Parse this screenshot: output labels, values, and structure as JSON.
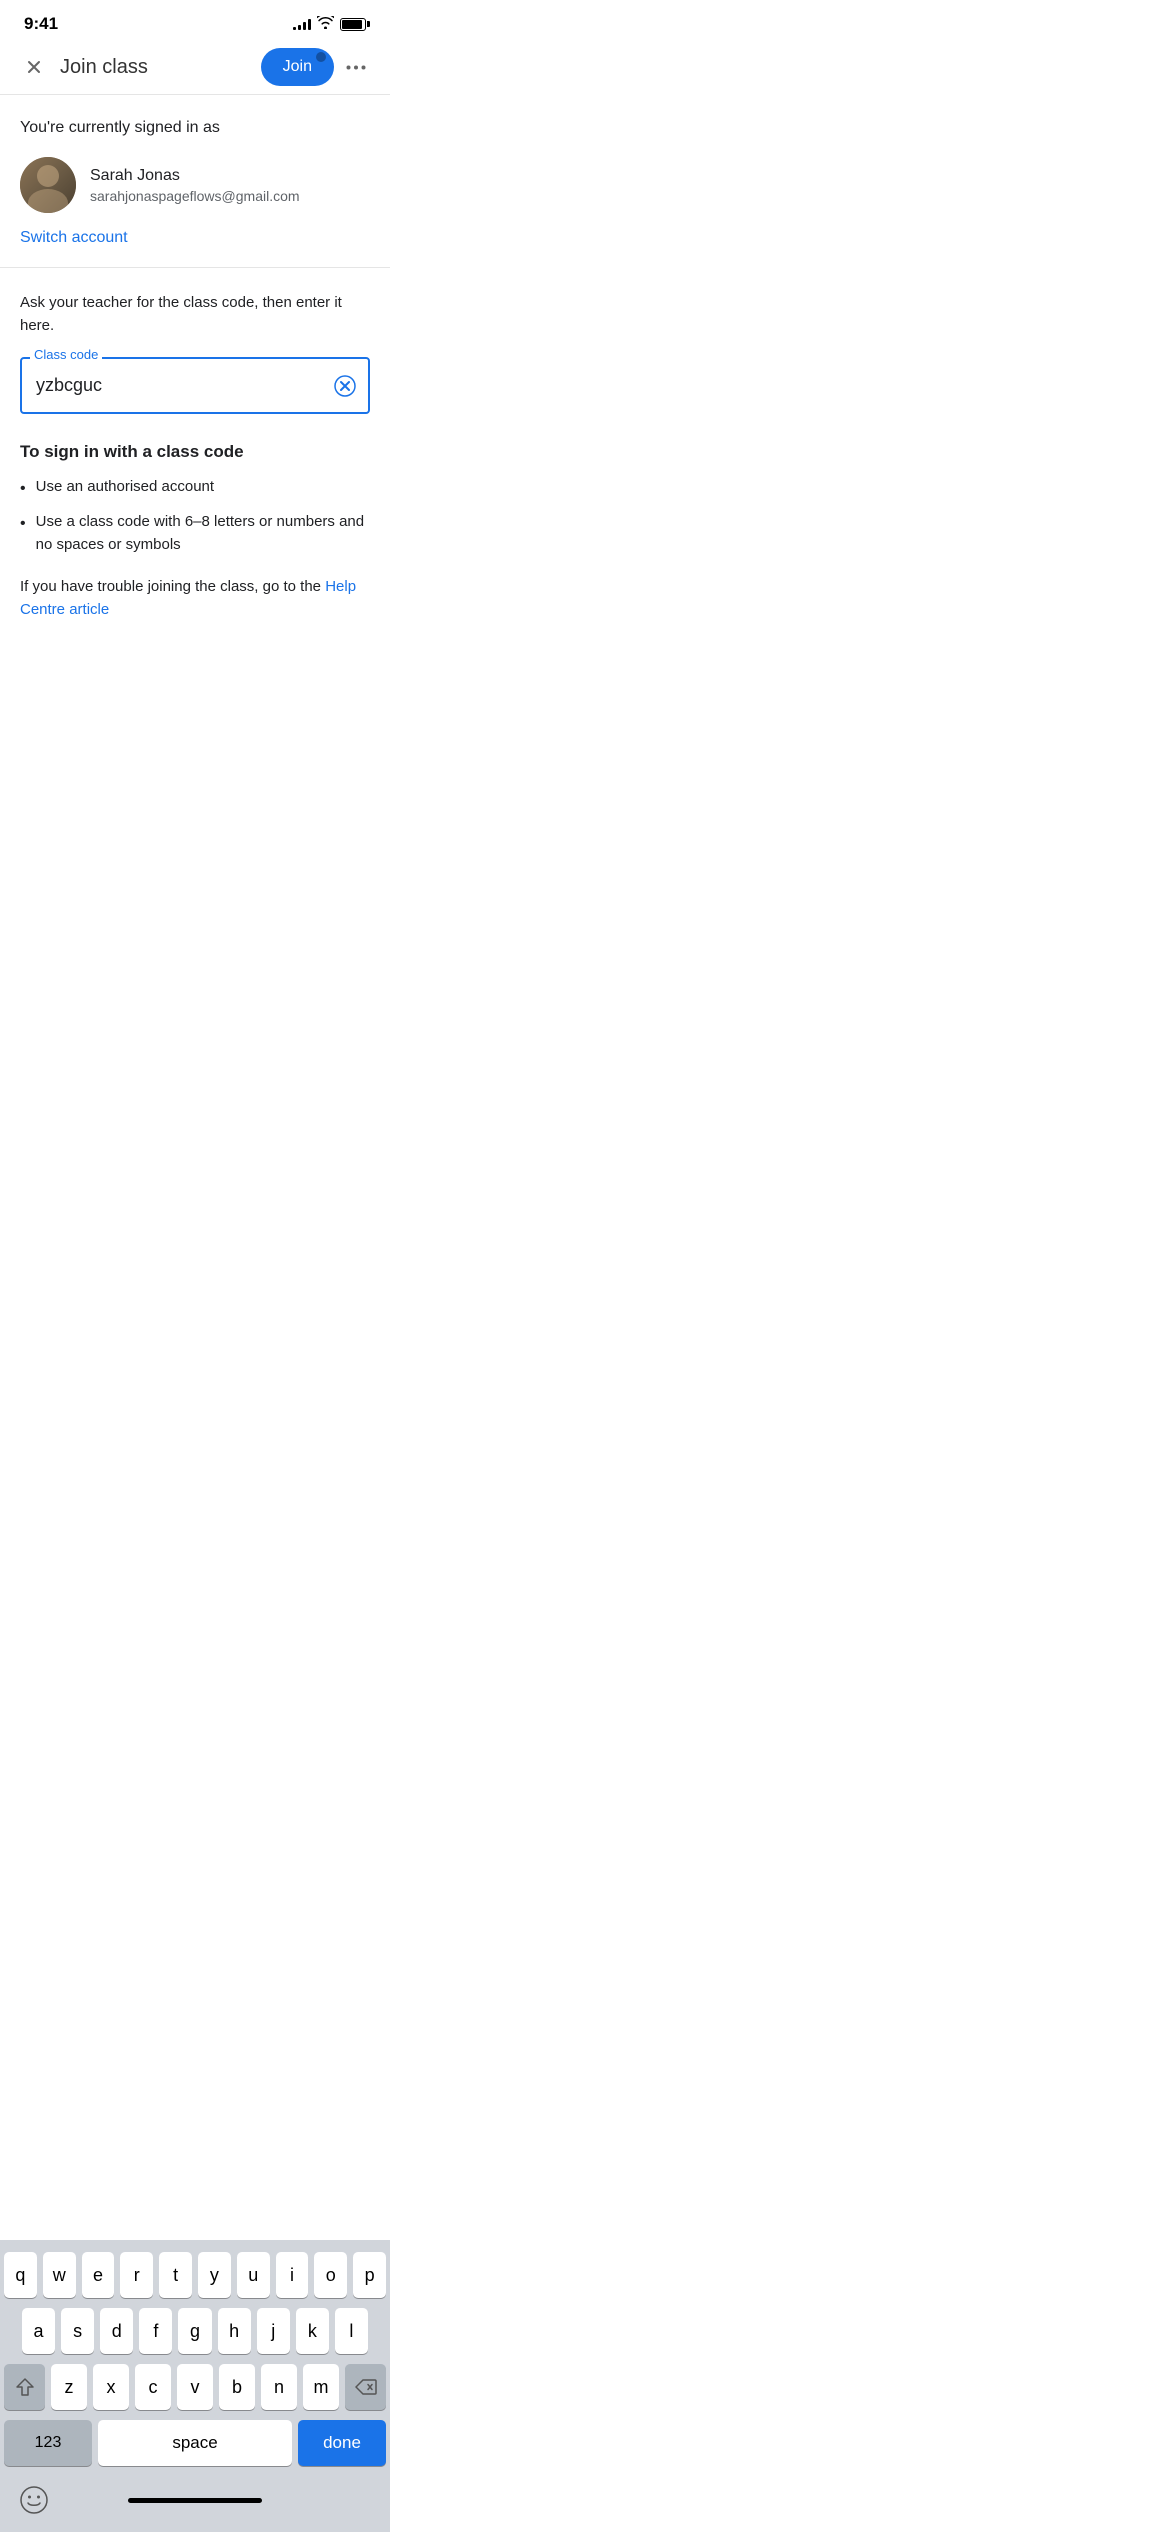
{
  "statusBar": {
    "time": "9:41"
  },
  "navBar": {
    "title": "Join class",
    "joinLabel": "Join",
    "moreLabel": "···"
  },
  "signedIn": {
    "label": "You're currently signed in as",
    "userName": "Sarah Jonas",
    "userEmail": "sarahjonaspageflows@gmail.com",
    "switchLabel": "Switch account"
  },
  "form": {
    "instruction": "Ask your teacher for the class code, then enter it here.",
    "inputLabel": "Class code",
    "inputValue": "yzbcguc",
    "inputPlaceholder": ""
  },
  "instructions": {
    "title": "To sign in with a class code",
    "items": [
      "Use an authorised account",
      "Use a class code with 6–8 letters or numbers and no spaces or symbols"
    ],
    "troublePrefix": "If you have trouble joining the class, go to the ",
    "helpLink": "Help Centre article",
    "troubleSuffix": "."
  },
  "keyboard": {
    "rows": [
      [
        "q",
        "w",
        "e",
        "r",
        "t",
        "y",
        "u",
        "i",
        "o",
        "p"
      ],
      [
        "a",
        "s",
        "d",
        "f",
        "g",
        "h",
        "j",
        "k",
        "l"
      ],
      [
        "z",
        "x",
        "c",
        "v",
        "b",
        "n",
        "m"
      ]
    ],
    "numbersLabel": "123",
    "spaceLabel": "space",
    "doneLabel": "done"
  },
  "colors": {
    "accent": "#1a73e8",
    "text": "#202124",
    "secondary": "#5f6368",
    "divider": "#e5e5e5"
  }
}
